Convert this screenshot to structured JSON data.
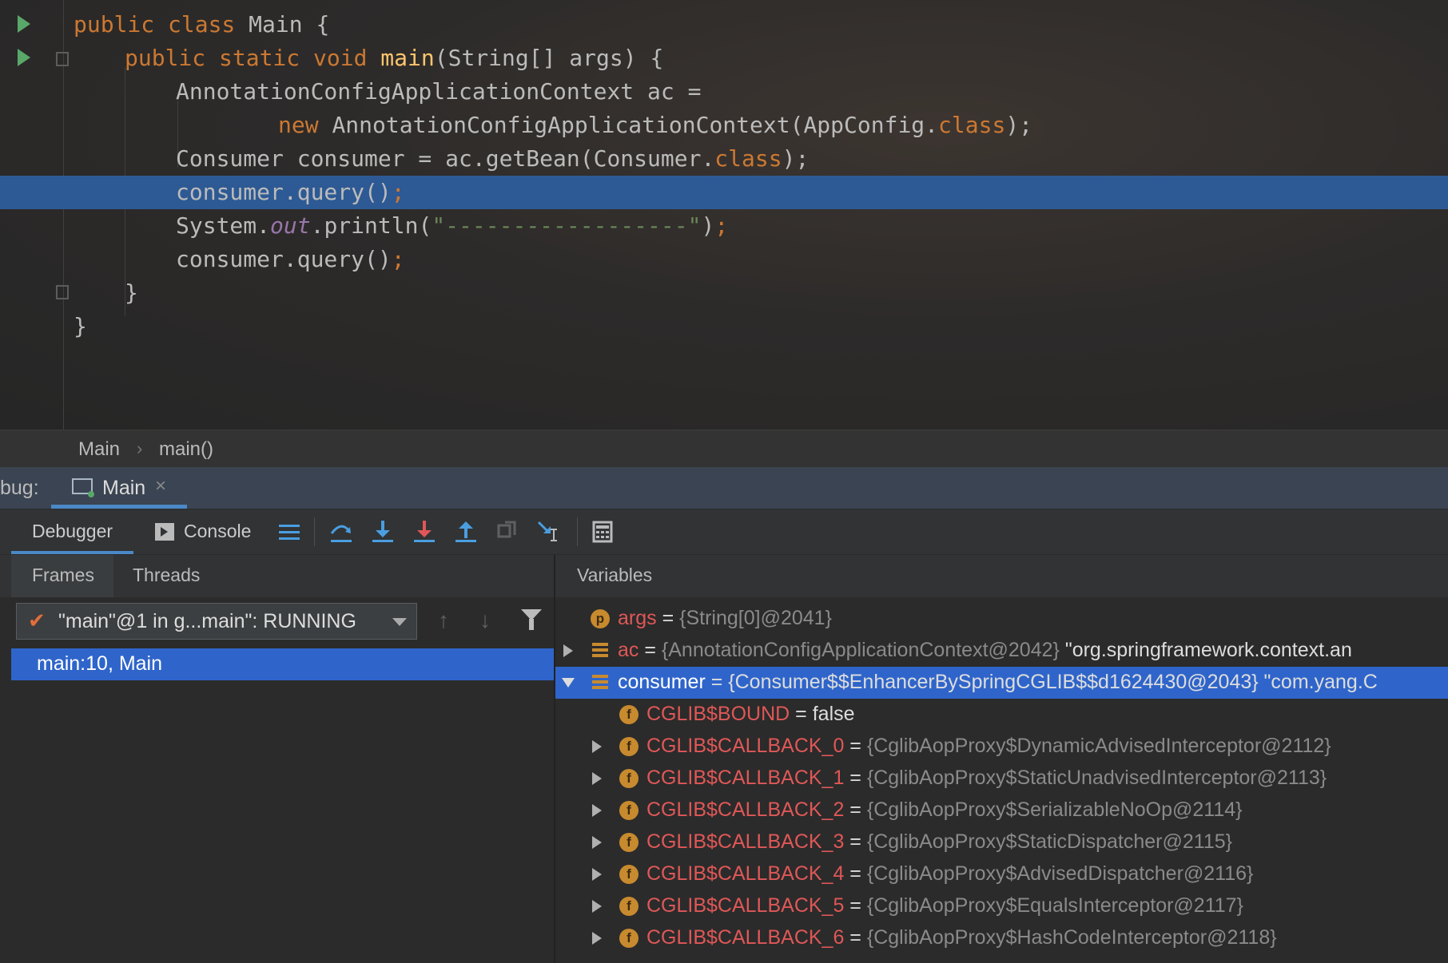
{
  "editor": {
    "lines": [
      {
        "tokens": [
          {
            "t": "public class ",
            "c": "kw"
          },
          {
            "t": "Main {",
            "c": ""
          }
        ]
      },
      {
        "tokens": [
          {
            "t": "public static void ",
            "c": "kw"
          },
          {
            "t": "main",
            "c": "fn"
          },
          {
            "t": "(String[] args) {",
            "c": ""
          }
        ]
      },
      {
        "tokens": [
          {
            "t": "AnnotationConfigApplicationContext ac =",
            "c": ""
          }
        ]
      },
      {
        "tokens": [
          {
            "t": "new ",
            "c": "kw"
          },
          {
            "t": "AnnotationConfigApplicationContext(AppConfig.",
            "c": ""
          },
          {
            "t": "class",
            "c": "kw"
          },
          {
            "t": ");",
            "c": ""
          }
        ]
      },
      {
        "tokens": [
          {
            "t": "Consumer consumer = ac.getBean(Consumer.",
            "c": ""
          },
          {
            "t": "class",
            "c": "kw"
          },
          {
            "t": ");",
            "c": ""
          }
        ]
      },
      {
        "tokens": [
          {
            "t": "consumer.query()",
            "c": ""
          },
          {
            "t": ";",
            "c": "kw"
          }
        ]
      },
      {
        "tokens": [
          {
            "t": "System.",
            "c": ""
          },
          {
            "t": "out",
            "c": "it"
          },
          {
            "t": ".println(",
            "c": ""
          },
          {
            "t": "\"------------------\"",
            "c": "str"
          },
          {
            "t": ")",
            "c": ""
          },
          {
            "t": ";",
            "c": "kw"
          }
        ]
      },
      {
        "tokens": [
          {
            "t": "consumer.query()",
            "c": ""
          },
          {
            "t": ";",
            "c": "kw"
          }
        ]
      },
      {
        "tokens": [
          {
            "t": "}",
            "c": ""
          }
        ]
      },
      {
        "tokens": [
          {
            "t": "}",
            "c": ""
          }
        ]
      }
    ]
  },
  "breadcrumb": {
    "class_name": "Main",
    "method_name": "main()"
  },
  "debug": {
    "label": "bug:",
    "tab_name": "Main",
    "close_glyph": "×"
  },
  "toolbar": {
    "debugger_label": "Debugger",
    "console_label": "Console"
  },
  "subtabs": {
    "frames_label": "Frames",
    "threads_label": "Threads",
    "variables_label": "Variables"
  },
  "frames": {
    "thread": "\"main\"@1 in g...main\": RUNNING",
    "check_glyph": "✔",
    "up_glyph": "↑",
    "down_glyph": "↓",
    "items": [
      "main:10, Main"
    ]
  },
  "variables": [
    {
      "icon": "p",
      "name": "args",
      "eq": " = ",
      "value": "{String[0]@2041}",
      "extra": ""
    },
    {
      "icon": "obj",
      "name": "ac",
      "eq": " = ",
      "value": "{AnnotationConfigApplicationContext@2042}",
      "extra": " \"org.springframework.context.an"
    },
    {
      "icon": "obj",
      "name": "consumer",
      "eq": " = ",
      "value": "{Consumer$$EnhancerBySpringCGLIB$$d1624430@2043}",
      "extra": " \"com.yang.C"
    },
    {
      "icon": "f",
      "name": "CGLIB$BOUND",
      "eq": " = ",
      "value": "false",
      "extra": ""
    },
    {
      "icon": "f",
      "name": "CGLIB$CALLBACK_0",
      "eq": " = ",
      "value": "{CglibAopProxy$DynamicAdvisedInterceptor@2112}",
      "extra": ""
    },
    {
      "icon": "f",
      "name": "CGLIB$CALLBACK_1",
      "eq": " = ",
      "value": "{CglibAopProxy$StaticUnadvisedInterceptor@2113}",
      "extra": ""
    },
    {
      "icon": "f",
      "name": "CGLIB$CALLBACK_2",
      "eq": " = ",
      "value": "{CglibAopProxy$SerializableNoOp@2114}",
      "extra": ""
    },
    {
      "icon": "f",
      "name": "CGLIB$CALLBACK_3",
      "eq": " = ",
      "value": "{CglibAopProxy$StaticDispatcher@2115}",
      "extra": ""
    },
    {
      "icon": "f",
      "name": "CGLIB$CALLBACK_4",
      "eq": " = ",
      "value": "{CglibAopProxy$AdvisedDispatcher@2116}",
      "extra": ""
    },
    {
      "icon": "f",
      "name": "CGLIB$CALLBACK_5",
      "eq": " = ",
      "value": "{CglibAopProxy$EqualsInterceptor@2117}",
      "extra": ""
    },
    {
      "icon": "f",
      "name": "CGLIB$CALLBACK_6",
      "eq": " = ",
      "value": "{CglibAopProxy$HashCodeInterceptor@2118}",
      "extra": ""
    }
  ],
  "colors": {
    "selection": "#2f65ca",
    "current_line": "#2d5a94",
    "keyword": "#cc7832",
    "field_name": "#e05757"
  }
}
